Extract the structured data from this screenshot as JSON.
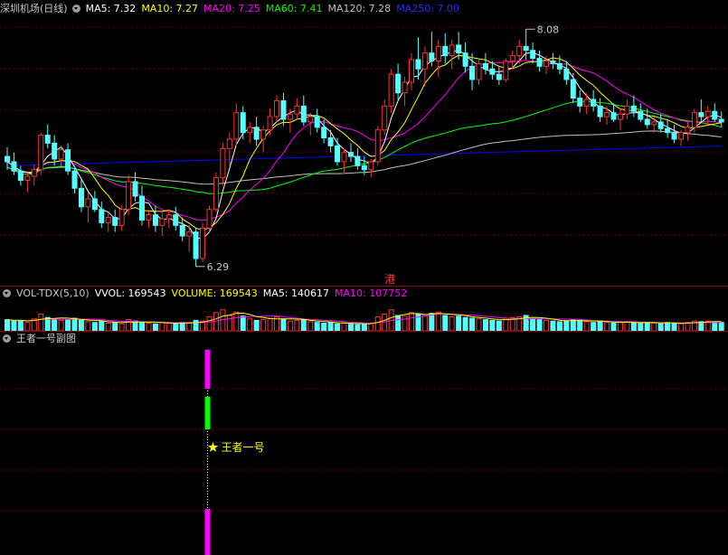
{
  "main_legend": {
    "title": "深圳机场(日线)",
    "items": [
      {
        "label": "MA5: 7.32",
        "color": "#ffffff"
      },
      {
        "label": "MA10: 7.27",
        "color": "#ffff00"
      },
      {
        "label": "MA20: 7.25",
        "color": "#ff00ff"
      },
      {
        "label": "MA60: 7.41",
        "color": "#00ff00"
      },
      {
        "label": "MA120: 7.28",
        "color": "#c0c0c0"
      },
      {
        "label": "MA250: 7.00",
        "color": "#0000ff"
      }
    ]
  },
  "vol_legend": {
    "title": "VOL-TDX(5,10)",
    "items": [
      {
        "label": "VVOL: 169543",
        "color": "#ffffff"
      },
      {
        "label": "VOLUME: 169543",
        "color": "#ffff00"
      },
      {
        "label": "MA5: 140617",
        "color": "#ffffff"
      },
      {
        "label": "MA10: 107752",
        "color": "#ff00ff"
      }
    ]
  },
  "sub_legend": {
    "title": "王者一号副图"
  },
  "annotations": {
    "high_label": "8.08",
    "low_label": "6.29",
    "hk_label": "港",
    "signal_label": "王者一号"
  },
  "colors": {
    "up": "#ff3232",
    "down": "#54ffff",
    "grid": "#7a0000",
    "ma5": "#ffffff",
    "ma10": "#ffff00",
    "ma20": "#ff00ff",
    "ma60": "#00ff00",
    "ma120": "#c0c0c0",
    "ma250": "#0000ff",
    "signal_magenta": "#ff00ff",
    "signal_green": "#00ff00",
    "signal_star": "#ffff00"
  },
  "chart_data": {
    "type": "candlestick",
    "title": "深圳机场(日线)",
    "price_range": [
      6.2,
      8.15
    ],
    "volume_range": [
      0,
      40000
    ],
    "high": {
      "value": 8.08,
      "index": 77
    },
    "low": {
      "value": 6.29,
      "index": 28
    },
    "signal_index": 30,
    "ohlc": [
      [
        7.12,
        7.19,
        7.02,
        7.08
      ],
      [
        7.08,
        7.15,
        6.98,
        7.01
      ],
      [
        7.01,
        7.05,
        6.9,
        6.94
      ],
      [
        6.94,
        7.0,
        6.85,
        6.97
      ],
      [
        6.97,
        7.06,
        6.9,
        7.02
      ],
      [
        7.02,
        7.3,
        6.98,
        7.28
      ],
      [
        7.28,
        7.36,
        7.18,
        7.22
      ],
      [
        7.22,
        7.28,
        7.05,
        7.1
      ],
      [
        7.1,
        7.2,
        7.05,
        7.17
      ],
      [
        7.17,
        7.22,
        6.98,
        7.01
      ],
      [
        7.01,
        7.05,
        6.84,
        6.88
      ],
      [
        6.88,
        6.95,
        6.7,
        6.74
      ],
      [
        6.74,
        6.85,
        6.62,
        6.8
      ],
      [
        6.8,
        6.86,
        6.7,
        6.72
      ],
      [
        6.72,
        6.78,
        6.58,
        6.62
      ],
      [
        6.62,
        6.7,
        6.55,
        6.66
      ],
      [
        6.66,
        6.72,
        6.55,
        6.6
      ],
      [
        6.6,
        6.75,
        6.56,
        6.72
      ],
      [
        6.72,
        6.98,
        6.68,
        6.93
      ],
      [
        6.93,
        7.0,
        6.78,
        6.82
      ],
      [
        6.82,
        6.9,
        6.6,
        6.64
      ],
      [
        6.64,
        6.72,
        6.58,
        6.68
      ],
      [
        6.68,
        6.75,
        6.55,
        6.6
      ],
      [
        6.6,
        6.7,
        6.52,
        6.65
      ],
      [
        6.65,
        6.72,
        6.58,
        6.68
      ],
      [
        6.68,
        6.74,
        6.56,
        6.6
      ],
      [
        6.6,
        6.66,
        6.48,
        6.52
      ],
      [
        6.52,
        6.6,
        6.4,
        6.55
      ],
      [
        6.55,
        6.58,
        6.29,
        6.35
      ],
      [
        6.35,
        6.62,
        6.32,
        6.58
      ],
      [
        6.58,
        6.75,
        6.55,
        6.72
      ],
      [
        6.72,
        7.0,
        6.7,
        6.96
      ],
      [
        6.96,
        7.22,
        6.9,
        7.18
      ],
      [
        7.18,
        7.3,
        7.05,
        7.25
      ],
      [
        7.25,
        7.52,
        7.2,
        7.45
      ],
      [
        7.45,
        7.5,
        7.25,
        7.3
      ],
      [
        7.3,
        7.38,
        7.22,
        7.34
      ],
      [
        7.34,
        7.42,
        7.2,
        7.25
      ],
      [
        7.25,
        7.35,
        7.15,
        7.32
      ],
      [
        7.32,
        7.48,
        7.28,
        7.42
      ],
      [
        7.42,
        7.58,
        7.38,
        7.54
      ],
      [
        7.54,
        7.6,
        7.35,
        7.4
      ],
      [
        7.4,
        7.48,
        7.3,
        7.44
      ],
      [
        7.44,
        7.56,
        7.4,
        7.5
      ],
      [
        7.5,
        7.58,
        7.35,
        7.38
      ],
      [
        7.38,
        7.45,
        7.28,
        7.42
      ],
      [
        7.42,
        7.48,
        7.3,
        7.34
      ],
      [
        7.34,
        7.4,
        7.22,
        7.26
      ],
      [
        7.26,
        7.32,
        7.15,
        7.2
      ],
      [
        7.2,
        7.26,
        7.05,
        7.08
      ],
      [
        7.08,
        7.18,
        7.0,
        7.15
      ],
      [
        7.15,
        7.22,
        7.08,
        7.12
      ],
      [
        7.12,
        7.18,
        7.02,
        7.05
      ],
      [
        7.05,
        7.12,
        6.98,
        7.02
      ],
      [
        7.02,
        7.1,
        6.96,
        7.08
      ],
      [
        7.08,
        7.35,
        7.05,
        7.32
      ],
      [
        7.32,
        7.55,
        7.28,
        7.5
      ],
      [
        7.5,
        7.78,
        7.45,
        7.74
      ],
      [
        7.74,
        7.82,
        7.55,
        7.6
      ],
      [
        7.6,
        7.72,
        7.5,
        7.68
      ],
      [
        7.68,
        7.9,
        7.62,
        7.85
      ],
      [
        7.85,
        8.02,
        7.7,
        7.78
      ],
      [
        7.78,
        7.95,
        7.65,
        7.9
      ],
      [
        7.9,
        8.06,
        7.8,
        7.84
      ],
      [
        7.84,
        8.0,
        7.72,
        7.95
      ],
      [
        7.95,
        8.05,
        7.82,
        7.88
      ],
      [
        7.88,
        8.0,
        7.78,
        7.96
      ],
      [
        7.96,
        8.06,
        7.85,
        7.9
      ],
      [
        7.9,
        7.98,
        7.75,
        7.8
      ],
      [
        7.8,
        7.9,
        7.62,
        7.7
      ],
      [
        7.7,
        7.85,
        7.66,
        7.82
      ],
      [
        7.82,
        7.9,
        7.74,
        7.78
      ],
      [
        7.78,
        7.84,
        7.7,
        7.74
      ],
      [
        7.74,
        7.8,
        7.66,
        7.7
      ],
      [
        7.7,
        7.86,
        7.68,
        7.84
      ],
      [
        7.84,
        7.92,
        7.78,
        7.88
      ],
      [
        7.88,
        8.0,
        7.82,
        7.95
      ],
      [
        7.95,
        8.08,
        7.85,
        7.92
      ],
      [
        7.92,
        7.98,
        7.82,
        7.86
      ],
      [
        7.86,
        7.92,
        7.76,
        7.8
      ],
      [
        7.8,
        7.88,
        7.74,
        7.84
      ],
      [
        7.84,
        7.9,
        7.78,
        7.82
      ],
      [
        7.82,
        7.88,
        7.74,
        7.78
      ],
      [
        7.78,
        7.84,
        7.66,
        7.7
      ],
      [
        7.7,
        7.75,
        7.52,
        7.56
      ],
      [
        7.56,
        7.62,
        7.45,
        7.5
      ],
      [
        7.5,
        7.6,
        7.44,
        7.55
      ],
      [
        7.55,
        7.62,
        7.46,
        7.5
      ],
      [
        7.5,
        7.56,
        7.38,
        7.42
      ],
      [
        7.42,
        7.5,
        7.36,
        7.45
      ],
      [
        7.45,
        7.52,
        7.38,
        7.4
      ],
      [
        7.4,
        7.48,
        7.32,
        7.44
      ],
      [
        7.44,
        7.55,
        7.4,
        7.5
      ],
      [
        7.5,
        7.58,
        7.42,
        7.46
      ],
      [
        7.46,
        7.52,
        7.38,
        7.4
      ],
      [
        7.4,
        7.48,
        7.33,
        7.36
      ],
      [
        7.36,
        7.42,
        7.3,
        7.38
      ],
      [
        7.38,
        7.44,
        7.3,
        7.33
      ],
      [
        7.33,
        7.4,
        7.26,
        7.3
      ],
      [
        7.3,
        7.36,
        7.22,
        7.25
      ],
      [
        7.25,
        7.32,
        7.2,
        7.3
      ],
      [
        7.3,
        7.38,
        7.24,
        7.34
      ],
      [
        7.34,
        7.48,
        7.3,
        7.45
      ],
      [
        7.45,
        7.55,
        7.38,
        7.42
      ],
      [
        7.42,
        7.5,
        7.36,
        7.46
      ],
      [
        7.46,
        7.52,
        7.38,
        7.4
      ],
      [
        7.4,
        7.46,
        7.34,
        7.38
      ]
    ],
    "volume": [
      16000,
      14000,
      15000,
      12000,
      17000,
      24000,
      19000,
      17000,
      15000,
      16000,
      18000,
      15000,
      13000,
      12000,
      14000,
      11000,
      12000,
      10000,
      16000,
      14000,
      12000,
      11000,
      10000,
      12000,
      11000,
      10000,
      12000,
      11000,
      15000,
      14000,
      20000,
      26000,
      30000,
      22000,
      27000,
      21000,
      17000,
      15000,
      16000,
      18000,
      20000,
      17000,
      14000,
      15000,
      16000,
      13000,
      12000,
      11000,
      12000,
      10000,
      11000,
      10000,
      9000,
      10000,
      11000,
      20000,
      24000,
      30000,
      22000,
      21000,
      26000,
      24000,
      23000,
      25000,
      27000,
      22000,
      20000,
      21000,
      19000,
      18000,
      17000,
      16000,
      15000,
      14000,
      18000,
      19000,
      20000,
      22000,
      17000,
      16000,
      15000,
      14000,
      13000,
      14000,
      16000,
      15000,
      13000,
      12000,
      14000,
      12000,
      11000,
      12000,
      13000,
      12000,
      11000,
      12000,
      11000,
      10000,
      12000,
      11000,
      10000,
      12000,
      14000,
      13000,
      14000,
      13000,
      12000
    ]
  }
}
